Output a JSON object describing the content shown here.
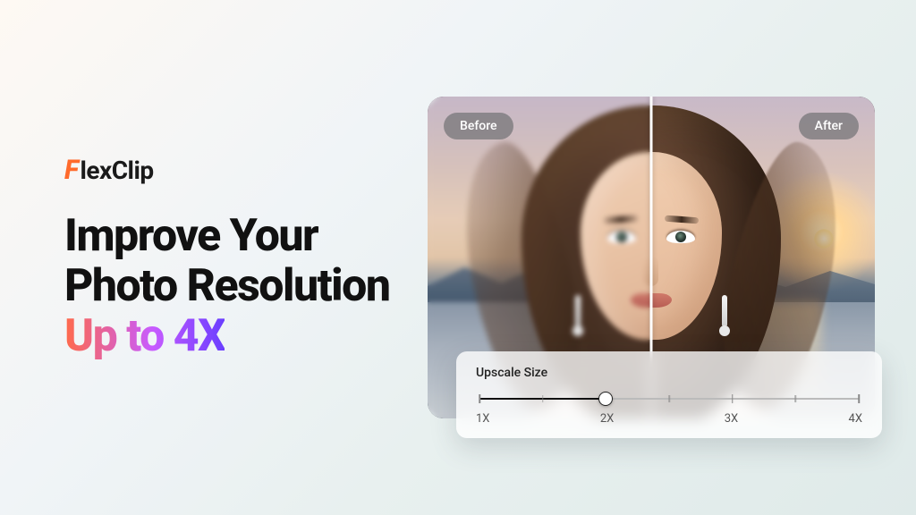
{
  "brand": {
    "f": "F",
    "rest": "lexClip"
  },
  "headline": {
    "line1": "Improve Your",
    "line2": "Photo Resolution",
    "accent": "Up to 4X"
  },
  "compare": {
    "before": "Before",
    "after": "After",
    "split_pct": 50
  },
  "panel": {
    "title": "Upscale Size",
    "value_index": 1,
    "options": [
      "1X",
      "2X",
      "3X",
      "4X"
    ]
  },
  "colors": {
    "logo_accent": "#ff6a2b",
    "grad_start": "#ff6a4a",
    "grad_mid": "#c85bff",
    "grad_end": "#6a3eff"
  }
}
